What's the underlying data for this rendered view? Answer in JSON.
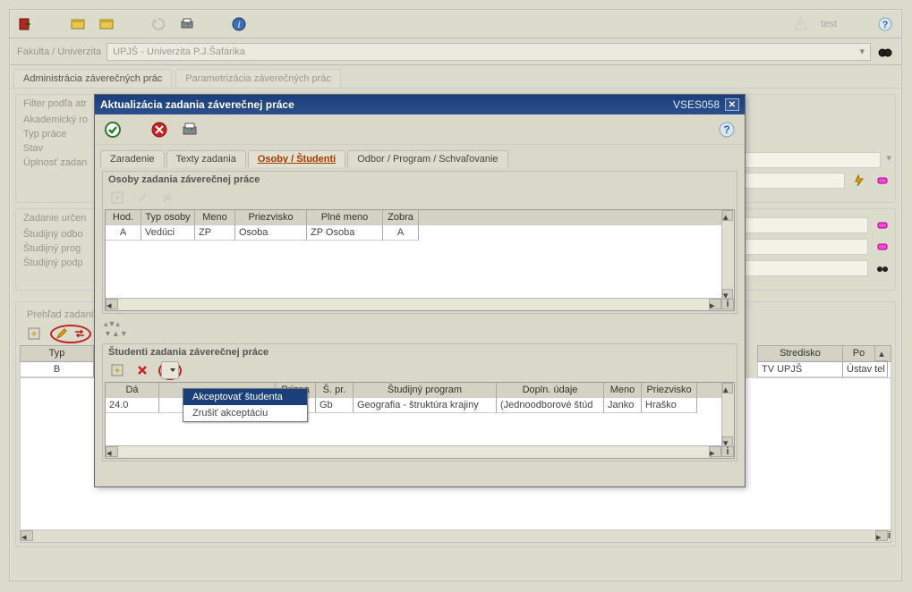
{
  "app": {
    "test_label": "test",
    "university_label": "Fakulta / Univerzita",
    "university_value": "UPJŠ - Univerzita P.J.Šafárika"
  },
  "main_tabs": [
    {
      "label": "Administrácia záverečných prác",
      "active": true
    },
    {
      "label": "Parametrizácia záverečných prác",
      "active": false
    }
  ],
  "filters": {
    "panel_title": "Filter podľa atr",
    "rows": [
      "Akademický ro",
      "Typ práce",
      "Stav",
      "Úplnosť zadan"
    ],
    "panel2_title": "Zadanie určen",
    "rows2": [
      "Študijný odbo",
      "Študijný prog",
      "Študijný podp"
    ],
    "prehlad": "Prehľad zadaní"
  },
  "bg_grid": {
    "left_col": "Typ",
    "left_value": "B",
    "right_cols": [
      "Stredisko",
      "Po"
    ],
    "right_values": [
      "TV UPJŠ",
      "Ústav tel"
    ]
  },
  "dialog": {
    "title": "Aktualizácia zadania záverečnej práce",
    "code": "VSES058",
    "tabs": [
      "Zaradenie",
      "Texty zadania",
      "Osoby / Študenti",
      "Odbor / Program / Schvaľovanie"
    ],
    "active_tab_index": 2,
    "section1": {
      "title": "Osoby zadania záverečnej práce",
      "headers": [
        "Hod.",
        "Typ osoby",
        "Meno",
        "Priezvisko",
        "Plné meno",
        "Zobra"
      ],
      "widths": [
        40,
        60,
        45,
        80,
        85,
        40
      ],
      "rows": [
        {
          "hod": "A",
          "typ": "Vedúci",
          "meno": "ZP",
          "priez": "Osoba",
          "plne": "ZP Osoba",
          "zob": "A"
        }
      ]
    },
    "section2": {
      "title": "Študenti zadania záverečnej práce",
      "headers": [
        "Dá",
        "",
        "Prizna",
        "Š. pr.",
        "Študijný program",
        "Dopln. údaje",
        "Meno",
        "Priezvisko"
      ],
      "widths": [
        60,
        130,
        45,
        42,
        160,
        120,
        42,
        62
      ],
      "rows": [
        {
          "da": "24.0",
          "c1": "",
          "priz": "",
          "spr": "Gb",
          "program": "Geografia - štruktúra krajiny",
          "dopl": "(Jednoodborové štúd",
          "meno": "Janko",
          "priez": "Hraško"
        }
      ]
    }
  },
  "popup": {
    "items": [
      "Akceptovať študenta",
      "Zrušiť akceptáciu"
    ],
    "selected": 0
  }
}
